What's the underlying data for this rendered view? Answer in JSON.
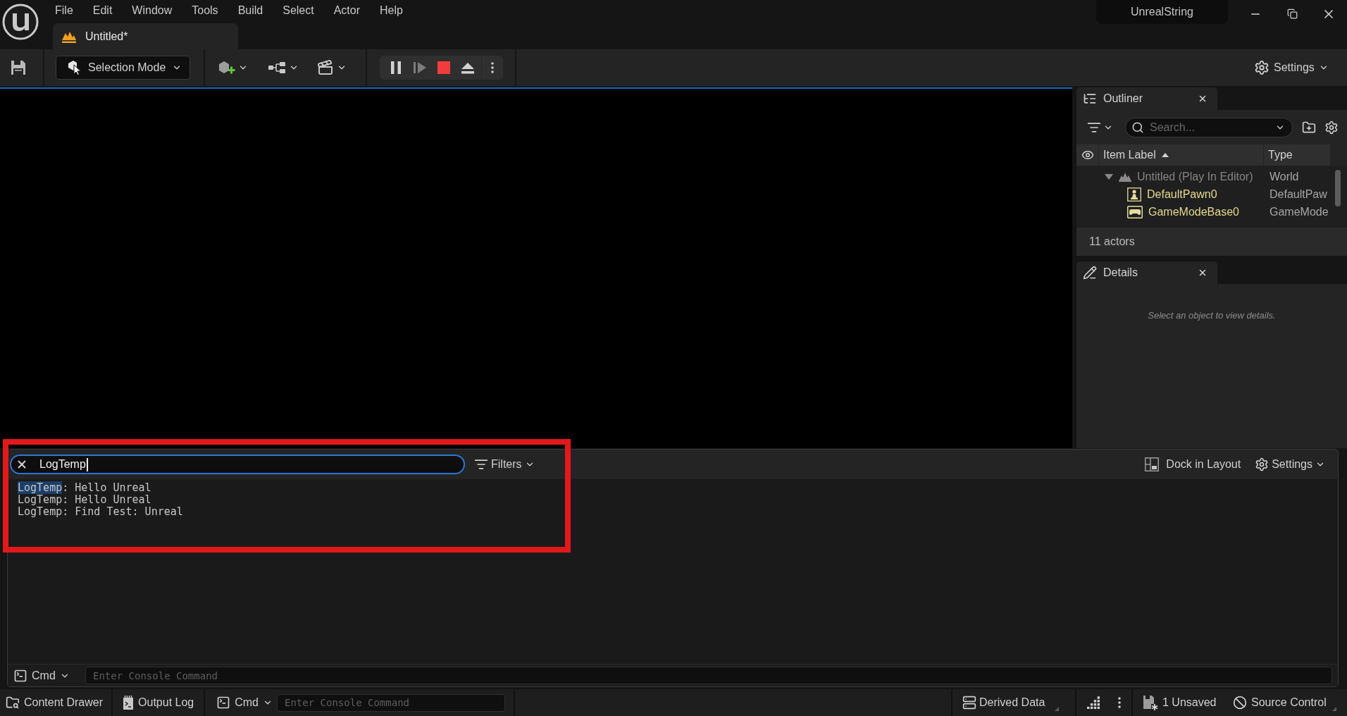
{
  "window": {
    "project": "UnrealString"
  },
  "menu": [
    "File",
    "Edit",
    "Window",
    "Tools",
    "Build",
    "Select",
    "Actor",
    "Help"
  ],
  "document_tab": {
    "title": "Untitled*"
  },
  "toolbar": {
    "mode": "Selection Mode",
    "settings": "Settings"
  },
  "outliner": {
    "tab": "Outliner",
    "search": {
      "placeholder": "Search..."
    },
    "columns": [
      "Item Label",
      "Type"
    ],
    "tree": [
      {
        "label": "Untitled (Play In Editor)",
        "type": "World",
        "kind": "world",
        "expanded": true,
        "children": [
          {
            "label": "DefaultPawn0",
            "type": "DefaultPaw",
            "kind": "pawn"
          },
          {
            "label": "GameModeBase0",
            "type": "GameMode",
            "kind": "game-mode"
          }
        ]
      }
    ],
    "footer": "11 actors"
  },
  "details": {
    "tab": "Details",
    "message": "Select an object to view details."
  },
  "output_log": {
    "search": {
      "value": "LogTemp"
    },
    "filters": "Filters",
    "dock": "Dock in Layout",
    "settings": "Settings",
    "lines": [
      {
        "category": "LogTemp",
        "message": ": Hello Unreal",
        "highlighted": true
      },
      {
        "category": "LogTemp",
        "message": ": Hello Unreal",
        "highlighted": false
      },
      {
        "category": "LogTemp",
        "message": ": Find Test: Unreal",
        "highlighted": false
      }
    ],
    "console": {
      "mode": "Cmd",
      "placeholder": "Enter Console Command"
    }
  },
  "status_bar": {
    "content_drawer": "Content Drawer",
    "output_log": "Output Log",
    "console": {
      "mode": "Cmd",
      "placeholder": "Enter Console Command"
    },
    "derived_data": "Derived Data",
    "unsaved": "1 Unsaved",
    "source_control": "Source Control"
  }
}
